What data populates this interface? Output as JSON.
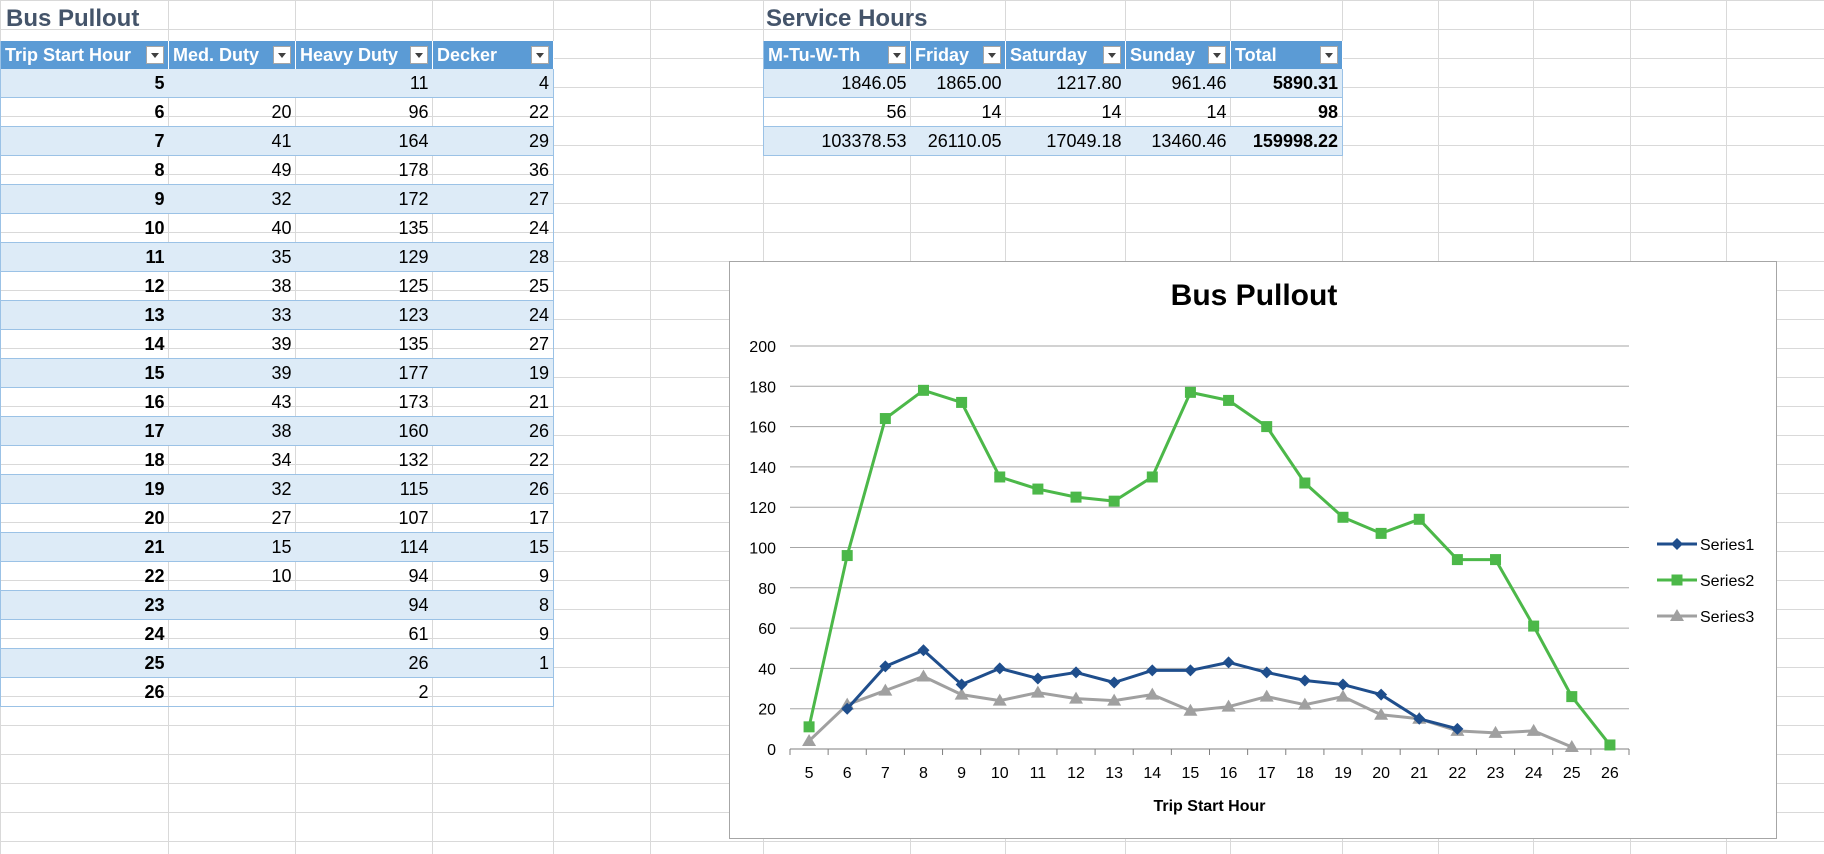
{
  "bus_pullout": {
    "title": "Bus Pullout",
    "headers": [
      "Trip Start Hour",
      "Med. Duty",
      "Heavy Duty",
      "Decker"
    ],
    "rows": [
      [
        "5",
        "",
        "11",
        "4"
      ],
      [
        "6",
        "20",
        "96",
        "22"
      ],
      [
        "7",
        "41",
        "164",
        "29"
      ],
      [
        "8",
        "49",
        "178",
        "36"
      ],
      [
        "9",
        "32",
        "172",
        "27"
      ],
      [
        "10",
        "40",
        "135",
        "24"
      ],
      [
        "11",
        "35",
        "129",
        "28"
      ],
      [
        "12",
        "38",
        "125",
        "25"
      ],
      [
        "13",
        "33",
        "123",
        "24"
      ],
      [
        "14",
        "39",
        "135",
        "27"
      ],
      [
        "15",
        "39",
        "177",
        "19"
      ],
      [
        "16",
        "43",
        "173",
        "21"
      ],
      [
        "17",
        "38",
        "160",
        "26"
      ],
      [
        "18",
        "34",
        "132",
        "22"
      ],
      [
        "19",
        "32",
        "115",
        "26"
      ],
      [
        "20",
        "27",
        "107",
        "17"
      ],
      [
        "21",
        "15",
        "114",
        "15"
      ],
      [
        "22",
        "10",
        "94",
        "9"
      ],
      [
        "23",
        "",
        "94",
        "8"
      ],
      [
        "24",
        "",
        "61",
        "9"
      ],
      [
        "25",
        "",
        "26",
        "1"
      ],
      [
        "26",
        "",
        "2",
        ""
      ]
    ]
  },
  "service_hours": {
    "title": "Service Hours",
    "headers": [
      "M-Tu-W-Th",
      "Friday",
      "Saturday",
      "Sunday",
      "Total"
    ],
    "rows": [
      [
        "1846.05",
        "1865.00",
        "1217.80",
        "961.46",
        "5890.31"
      ],
      [
        "56",
        "14",
        "14",
        "14",
        "98"
      ],
      [
        "103378.53",
        "26110.05",
        "17049.18",
        "13460.46",
        "159998.22"
      ]
    ]
  },
  "chart_data": {
    "type": "line",
    "title": "Bus Pullout",
    "xlabel": "Trip Start Hour",
    "ylabel": "",
    "x": [
      5,
      6,
      7,
      8,
      9,
      10,
      11,
      12,
      13,
      14,
      15,
      16,
      17,
      18,
      19,
      20,
      21,
      22,
      23,
      24,
      25,
      26
    ],
    "ylim": [
      0,
      200
    ],
    "yticks": [
      0,
      20,
      40,
      60,
      80,
      100,
      120,
      140,
      160,
      180,
      200
    ],
    "grid": true,
    "legend_position": "right",
    "series": [
      {
        "name": "Series1",
        "color": "#1f4e8c",
        "marker": "diamond",
        "values": [
          null,
          20,
          41,
          49,
          32,
          40,
          35,
          38,
          33,
          39,
          39,
          43,
          38,
          34,
          32,
          27,
          15,
          10,
          null,
          null,
          null,
          null
        ]
      },
      {
        "name": "Series2",
        "color": "#4cb849",
        "marker": "square",
        "values": [
          11,
          96,
          164,
          178,
          172,
          135,
          129,
          125,
          123,
          135,
          177,
          173,
          160,
          132,
          115,
          107,
          114,
          94,
          94,
          61,
          26,
          2
        ]
      },
      {
        "name": "Series3",
        "color": "#a0a0a0",
        "marker": "triangle",
        "values": [
          4,
          22,
          29,
          36,
          27,
          24,
          28,
          25,
          24,
          27,
          19,
          21,
          26,
          22,
          26,
          17,
          15,
          9,
          8,
          9,
          1,
          null
        ]
      }
    ]
  }
}
